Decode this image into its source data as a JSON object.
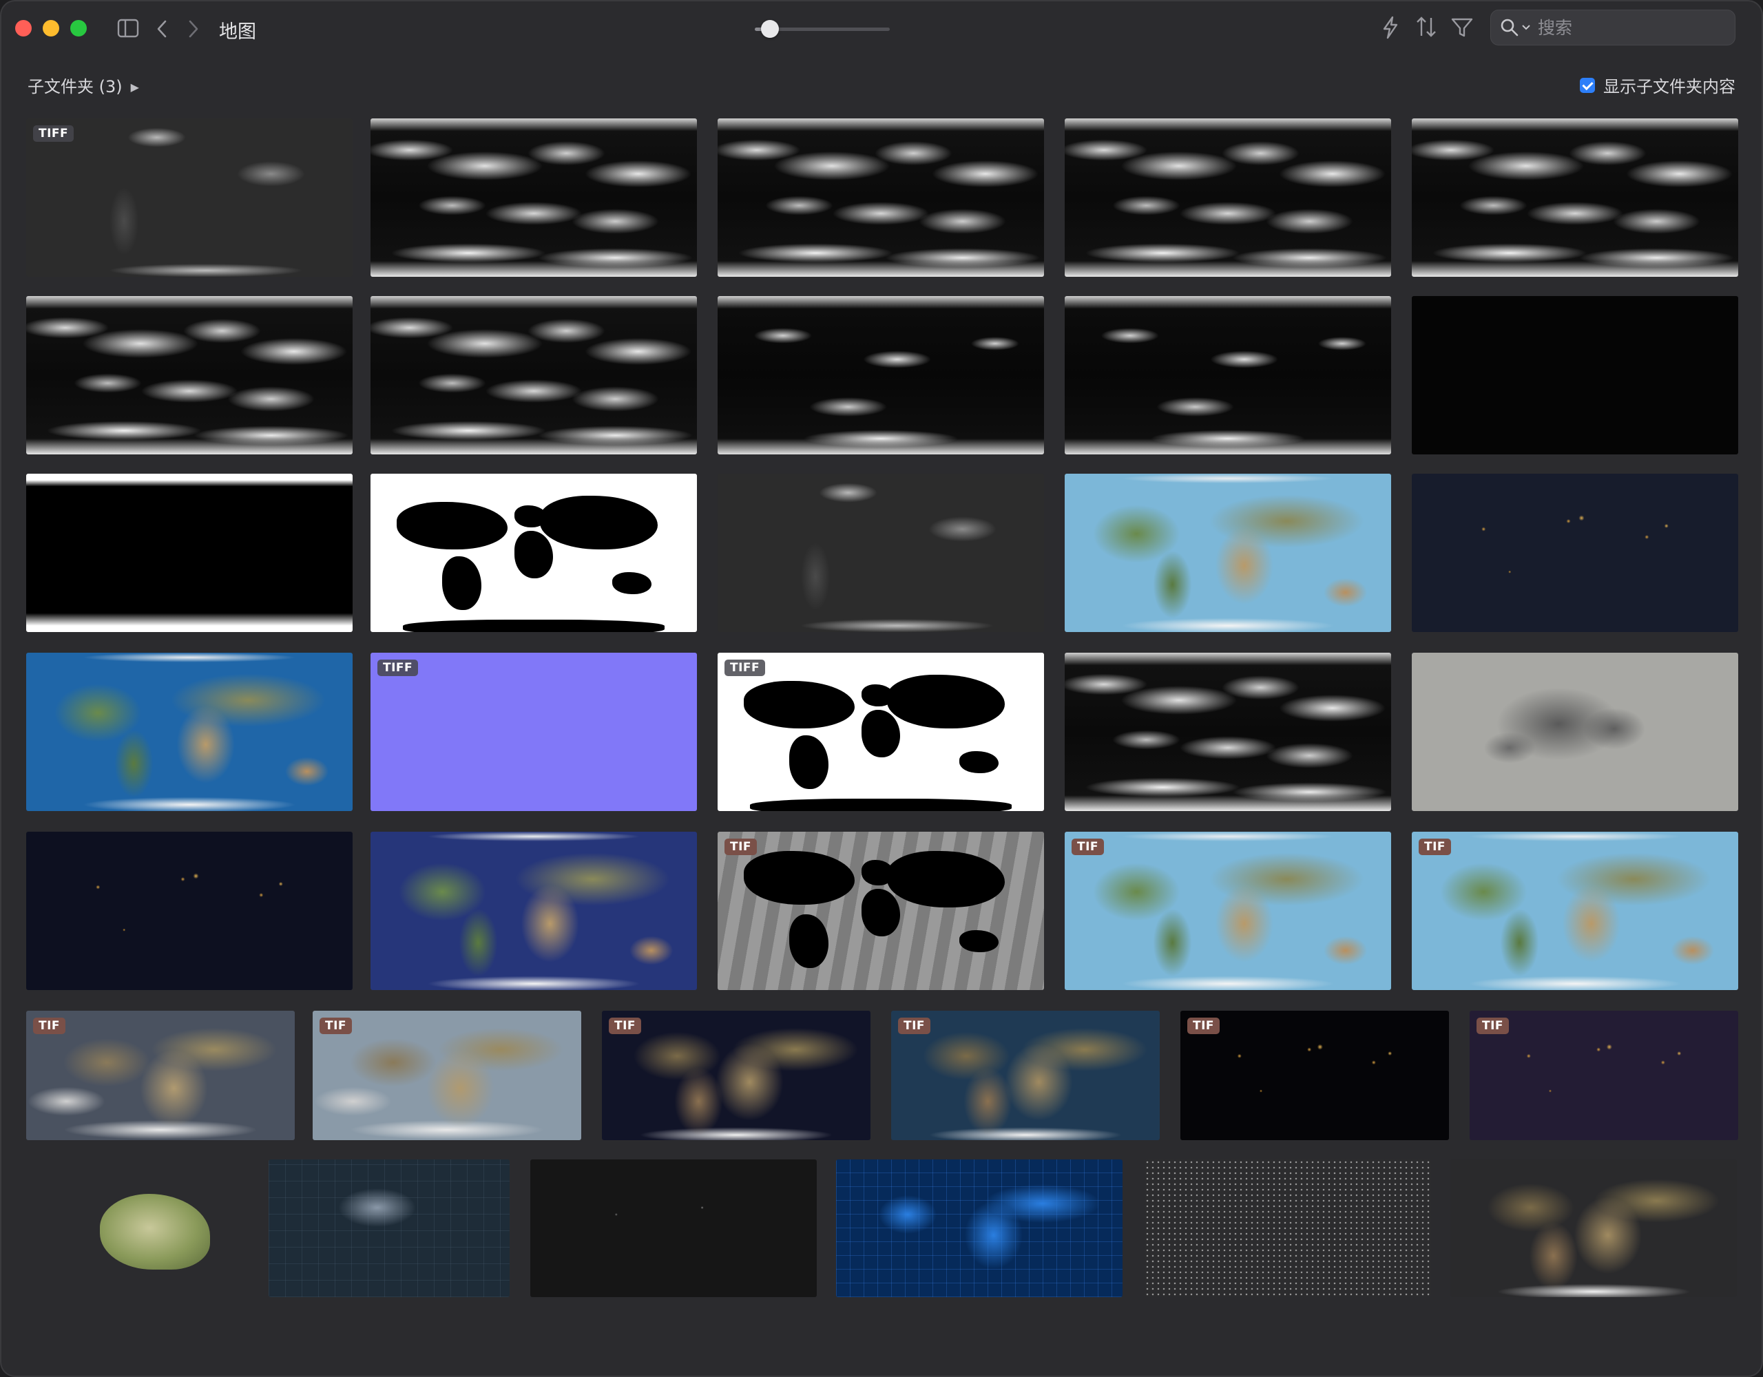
{
  "window": {
    "title": "地图"
  },
  "toolbar": {
    "zoom_level": 0.06,
    "search_placeholder": "搜索",
    "icons": [
      "sidebar-toggle-icon",
      "chevron-left-icon",
      "chevron-right-icon",
      "lightning-icon",
      "sort-icon",
      "filter-icon",
      "search-icon"
    ]
  },
  "header": {
    "subfolders_label": "子文件夹 (3)",
    "show_subfolder_label": "显示子文件夹内容",
    "show_subfolder_checked": true
  },
  "badges": {
    "tiff": "TIFF",
    "tif": "TIF"
  },
  "colors": {
    "window_bg": "#2b2b2e",
    "accent": "#2d7ff9",
    "close": "#ff5f57",
    "minimize": "#febc2e",
    "zoom": "#28c840",
    "tif_badge": "#7a5048"
  },
  "thumbnails": [
    {
      "style": "darkgray",
      "badge": "tiff"
    },
    {
      "style": "clouds"
    },
    {
      "style": "clouds"
    },
    {
      "style": "clouds"
    },
    {
      "style": "clouds"
    },
    {
      "style": "clouds"
    },
    {
      "style": "clouds"
    },
    {
      "style": "clouds2"
    },
    {
      "style": "clouds2"
    },
    {
      "style": "nearblack"
    },
    {
      "style": "blackland"
    },
    {
      "style": "bwmap"
    },
    {
      "style": "darkgray"
    },
    {
      "style": "bluemarble pale"
    },
    {
      "style": "nightlights navy"
    },
    {
      "style": "bluemarble"
    },
    {
      "style": "lavender",
      "badge": "tiff"
    },
    {
      "style": "bwmap",
      "badge": "tiff"
    },
    {
      "style": "clouds"
    },
    {
      "style": "moon"
    },
    {
      "style": "nightlights"
    },
    {
      "style": "bluemarble deep"
    },
    {
      "style": "graywater",
      "badge": "tif"
    },
    {
      "style": "bluemarble pale",
      "badge": "tif"
    },
    {
      "style": "bluemarble pale",
      "badge": "tif"
    },
    {
      "style": "earthclouds",
      "badge": "tif"
    },
    {
      "style": "earthclouds light",
      "badge": "tif"
    },
    {
      "style": "earthdark",
      "badge": "tif"
    },
    {
      "style": "earthdark teal",
      "badge": "tif"
    },
    {
      "style": "nightlights black",
      "badge": "tif"
    },
    {
      "style": "nightlights purple",
      "badge": "tif"
    },
    {
      "style": "china"
    },
    {
      "style": "teal-night"
    },
    {
      "style": "darkcity"
    },
    {
      "style": "blueneon"
    },
    {
      "style": "dotgrid"
    },
    {
      "style": "earthdark charcoal"
    }
  ]
}
